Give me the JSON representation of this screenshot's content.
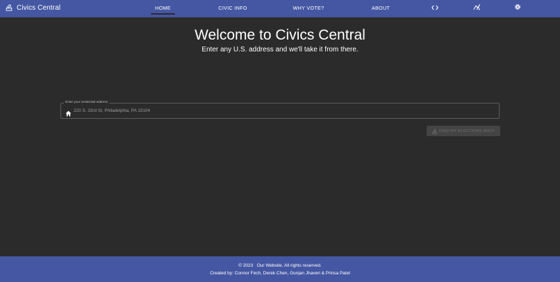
{
  "header": {
    "brand_title": "Civics Central",
    "brand_icon": "ballot-box-icon",
    "tabs": [
      {
        "label": "HOME",
        "active": true
      },
      {
        "label": "CIVIC INFO",
        "active": false
      },
      {
        "label": "WHY VOTE?",
        "active": false
      },
      {
        "label": "ABOUT",
        "active": false
      }
    ],
    "icons": [
      "code-icon",
      "accessibility-icon",
      "settings-icon"
    ]
  },
  "main": {
    "title": "Welcome to Civics Central",
    "subtitle": "Enter any U.S. address and we'll take it from there.",
    "address_label": "Enter your residential address",
    "address_placeholder": "220 S. 33rd St, Philadelphia, PA 19104",
    "address_value": "",
    "address_icon": "home-icon",
    "find_button_label": "FIND MY ELECTIONS INFO!",
    "find_button_icon": "ballot-box-icon",
    "find_button_disabled": true
  },
  "footer": {
    "copyright": "© 2023   Our Website. All rights reserved.",
    "credits": "Created by: Connor Fech, Derek Chen, Gunjan Jhaveri & Prinsa Patel"
  },
  "colors": {
    "primary": "#4557a3",
    "background": "#2b2b2b",
    "text": "#ffffff",
    "disabled_button": "#444444"
  }
}
